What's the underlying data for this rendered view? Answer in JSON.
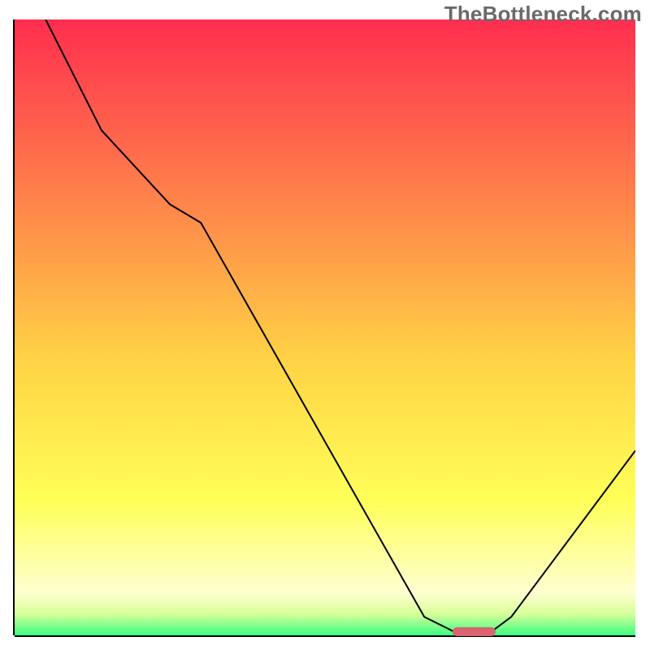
{
  "watermark": "TheBottleneck.com",
  "colors": {
    "grad_top": "#ff2d4f",
    "grad_mid_upper": "#ff944a",
    "grad_mid": "#ffd245",
    "grad_lower": "#ffff58",
    "grad_pale": "#ffffd0",
    "grad_green": "#3bff81",
    "curve": "#000000",
    "marker": "#d9636e",
    "axis": "#000000"
  },
  "chart_data": {
    "type": "line",
    "title": "",
    "xlabel": "",
    "ylabel": "",
    "xlim": [
      0,
      100
    ],
    "ylim": [
      0,
      100
    ],
    "x": [
      5,
      14,
      25,
      30,
      66,
      72,
      76,
      80,
      100
    ],
    "values": [
      100,
      82,
      70,
      67,
      3,
      0,
      0,
      3,
      30
    ],
    "marker": {
      "x_center": 74,
      "y": 0.6,
      "width": 7,
      "height": 1.4
    },
    "gradient_stops": [
      {
        "pos": 0.0,
        "color": "#ff2d4f"
      },
      {
        "pos": 0.35,
        "color": "#ff944a"
      },
      {
        "pos": 0.55,
        "color": "#ffd245"
      },
      {
        "pos": 0.78,
        "color": "#ffff58"
      },
      {
        "pos": 0.93,
        "color": "#ffffd0"
      },
      {
        "pos": 0.965,
        "color": "#d8ff9a"
      },
      {
        "pos": 1.0,
        "color": "#3bff81"
      }
    ]
  }
}
